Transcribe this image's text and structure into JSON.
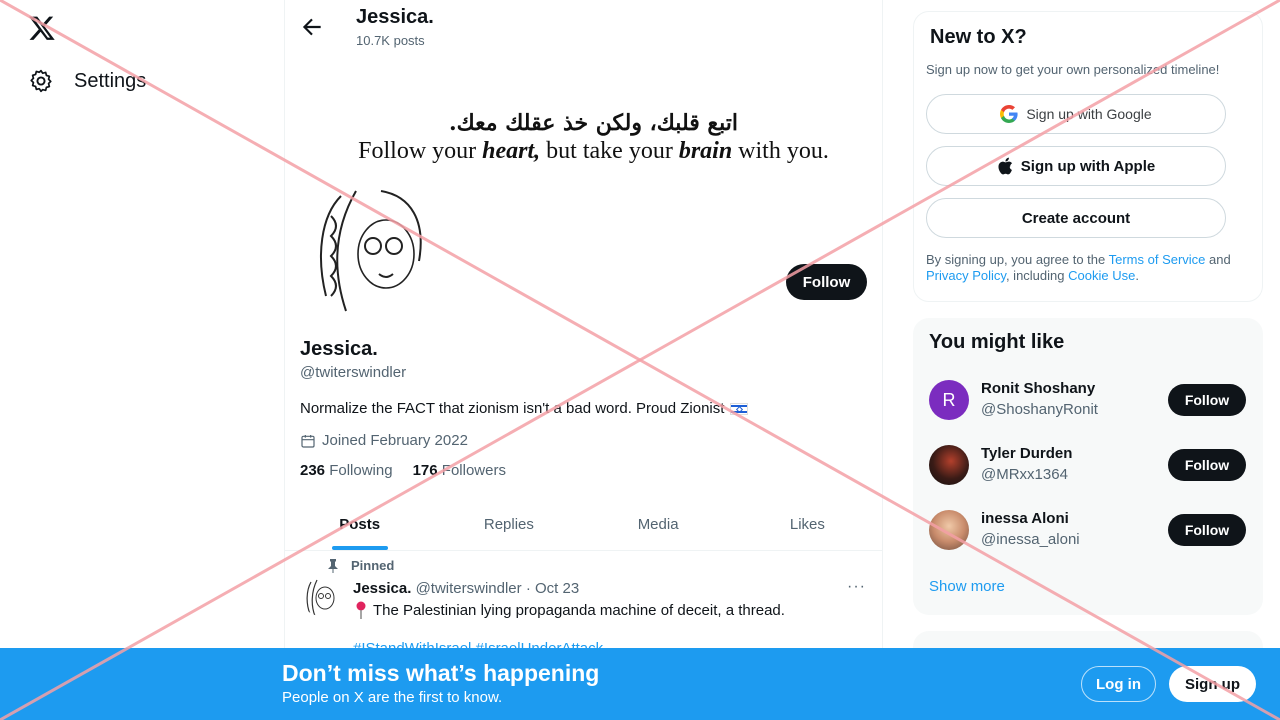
{
  "nav": {
    "logo": "x-logo",
    "settings_label": "Settings"
  },
  "header": {
    "name": "Jessica.",
    "posts": "10.7K posts"
  },
  "banner": {
    "arabic": "اتبع قلبك، ولكن خذ عقلك معك.",
    "english_pre": "Follow your ",
    "english_heart": "heart,",
    "english_mid": " but take your ",
    "english_brain": "brain",
    "english_post": " with you."
  },
  "profile": {
    "follow_label": "Follow",
    "name": "Jessica.",
    "handle": "@twiterswindler",
    "bio": "Normalize the FACT that zionism isn't a bad word. Proud Zionist",
    "joined": "Joined February 2022",
    "following_count": "236",
    "following_label": "Following",
    "followers_count": "176",
    "followers_label": "Followers"
  },
  "tabs": [
    {
      "label": "Posts",
      "active": true
    },
    {
      "label": "Replies",
      "active": false
    },
    {
      "label": "Media",
      "active": false
    },
    {
      "label": "Likes",
      "active": false
    }
  ],
  "post": {
    "pinned_label": "Pinned",
    "author": "Jessica.",
    "meta": "@twiterswindler · Oct 23",
    "more": "···",
    "text": "The Palestinian lying propaganda machine of deceit, a thread.",
    "link_partial": "#IStandWithIsrael #IsraelUnderAttack"
  },
  "signup_card": {
    "title": "New to X?",
    "subtitle": "Sign up now to get your own personalized timeline!",
    "google": "Sign up with Google",
    "apple": "Sign up with Apple",
    "create": "Create account",
    "terms_pre": "By signing up, you agree to the ",
    "terms_link": "Terms of Service",
    "terms_and": " and ",
    "privacy_link": "Privacy Policy",
    "terms_incl": ", including ",
    "cookie_link": "Cookie Use",
    "terms_end": "."
  },
  "suggestions": {
    "title": "You might like",
    "items": [
      {
        "name": "Ronit Shoshany",
        "handle": "@ShoshanyRonit",
        "follow": "Follow",
        "initial": "R",
        "color": "#7b2cbf"
      },
      {
        "name": "Tyler Durden",
        "handle": "@MRxx1364",
        "follow": "Follow",
        "color": "#3a1b16"
      },
      {
        "name": "inessa Aloni",
        "handle": "@inessa_aloni",
        "follow": "Follow",
        "color": "#c98c6c"
      }
    ],
    "show_more": "Show more"
  },
  "bottom_bar": {
    "headline": "Don’t miss what’s happening",
    "subline": "People on X are the first to know.",
    "login": "Log in",
    "signup": "Sign up"
  },
  "colors": {
    "accent": "#1d9bf0",
    "dark": "#0f1419",
    "muted": "#536471",
    "overlay": "#f4a0a6"
  }
}
